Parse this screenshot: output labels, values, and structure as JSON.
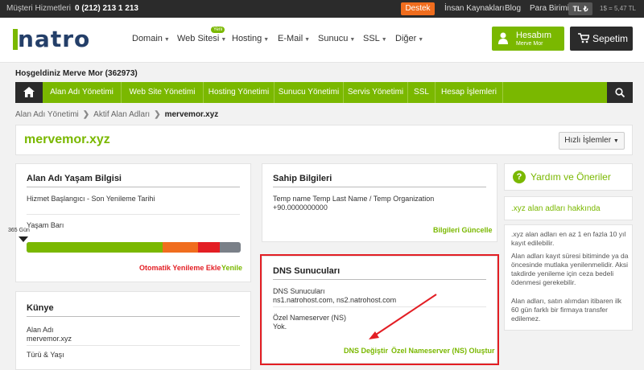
{
  "topbar": {
    "phone_label": "Müşteri Hizmetleri",
    "phone_number": "0 (212) 213 1 213",
    "support": "Destek",
    "hr": "İnsan Kaynakları",
    "blog": "Blog",
    "currency_label": "Para Birimi",
    "currency_value": "TL ₺",
    "rate": "1$ = 5,47 TL"
  },
  "header": {
    "logo": "natro",
    "nav": [
      "Domain",
      "Web Sitesi",
      "Hosting",
      "E-Mail",
      "Sunucu",
      "SSL",
      "Diğer"
    ],
    "new_badge": "Yeni",
    "account_title": "Hesabım",
    "account_name": "Merve Mor",
    "cart": "Sepetim"
  },
  "welcome": "Hoşgeldiniz Merve Mor (362973)",
  "menu": [
    "Alan Adı Yönetimi",
    "Web Site Yönetimi",
    "Hosting Yönetimi",
    "Sunucu Yönetimi",
    "Servis Yönetimi",
    "SSL",
    "Hesap İşlemleri"
  ],
  "breadcrumb": [
    "Alan Adı Yönetimi",
    "Aktif Alan Adları",
    "mervemor.xyz"
  ],
  "domain": {
    "name": "mervemor.xyz",
    "quick_actions": "Hızlı İşlemler"
  },
  "life": {
    "title": "Alan Adı Yaşam Bilgisi",
    "dates_label": "Hizmet Başlangıcı - Son Yenileme Tarihi",
    "bar_label": "Yaşam Barı",
    "days": "365 Gün",
    "auto_renew": "Otomatik Yenileme Ekle",
    "renew": "Yenile"
  },
  "identity": {
    "title": "Künye",
    "domain_label": "Alan Adı",
    "domain_value": "mervemor.xyz",
    "type_label": "Türü & Yaşı"
  },
  "owner": {
    "title": "Sahip Bilgileri",
    "line1": "Temp name Temp Last Name / Temp Organization",
    "line2": "+90.0000000000",
    "update": "Bilgileri Güncelle"
  },
  "dns": {
    "title": "DNS Sunucuları",
    "servers_label": "DNS Sunucuları",
    "servers_value": "ns1.natrohost.com, ns2.natrohost.com",
    "ns_label": "Özel Nameserver (NS)",
    "ns_value": "Yok.",
    "change": "DNS Değiştir",
    "create_ns": "Özel Nameserver (NS) Oluştur"
  },
  "help": {
    "title": "Yardım ve Öneriler",
    "subtitle": ".xyz alan adları hakkında",
    "p1": ".xyz alan adları en az 1 en fazla 10 yıl kayıt edilebilir.",
    "p2": "Alan adları kayıt süresi bitiminde ya da öncesinde mutlaka yenilenmelidir. Aksi takdirde yenileme için ceza bedeli ödenmesi gerekebilir.",
    "p3": "Alan adları, satın alımdan itibaren ilk 60 gün farklı bir firmaya transfer edilemez."
  },
  "colors": {
    "brand_green": "#7ab800",
    "dark": "#2b2b2b",
    "orange": "#f06d1e",
    "highlight_red": "#e31e24"
  }
}
